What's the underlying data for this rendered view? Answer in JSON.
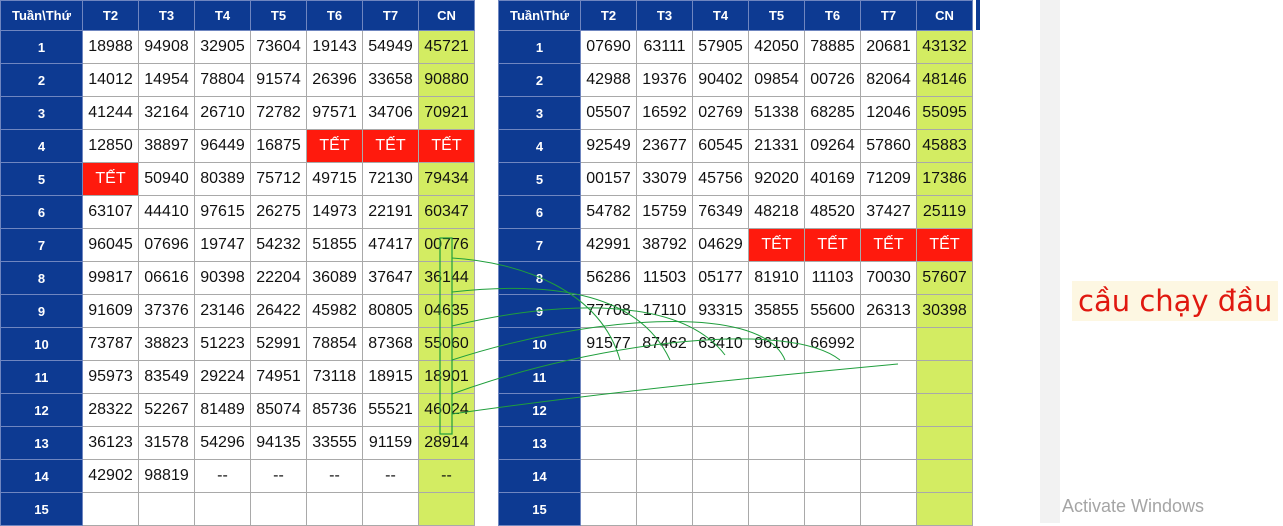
{
  "headers": [
    "Tuần\\Thứ",
    "T2",
    "T3",
    "T4",
    "T5",
    "T6",
    "T7",
    "CN"
  ],
  "left_rows": [
    {
      "week": "1",
      "values": [
        "18988",
        "94908",
        "32905",
        "73604",
        "19143",
        "54949",
        "45721"
      ]
    },
    {
      "week": "2",
      "values": [
        "14012",
        "14954",
        "78804",
        "91574",
        "26396",
        "33658",
        "90880"
      ]
    },
    {
      "week": "3",
      "values": [
        "41244",
        "32164",
        "26710",
        "72782",
        "97571",
        "34706",
        "70921"
      ]
    },
    {
      "week": "4",
      "values": [
        "12850",
        "38897",
        "96449",
        "16875",
        "TẾT",
        "TẾT",
        "TẾT"
      ]
    },
    {
      "week": "5",
      "values": [
        "TẾT",
        "50940",
        "80389",
        "75712",
        "49715",
        "72130",
        "79434"
      ]
    },
    {
      "week": "6",
      "values": [
        "63107",
        "44410",
        "97615",
        "26275",
        "14973",
        "22191",
        "60347"
      ]
    },
    {
      "week": "7",
      "values": [
        "96045",
        "07696",
        "19747",
        "54232",
        "51855",
        "47417",
        "00776"
      ]
    },
    {
      "week": "8",
      "values": [
        "99817",
        "06616",
        "90398",
        "22204",
        "36089",
        "37647",
        "36144"
      ]
    },
    {
      "week": "9",
      "values": [
        "91609",
        "37376",
        "23146",
        "26422",
        "45982",
        "80805",
        "04635"
      ]
    },
    {
      "week": "10",
      "values": [
        "73787",
        "38823",
        "51223",
        "52991",
        "78854",
        "87368",
        "55060"
      ]
    },
    {
      "week": "11",
      "values": [
        "95973",
        "83549",
        "29224",
        "74951",
        "73118",
        "18915",
        "18901"
      ]
    },
    {
      "week": "12",
      "values": [
        "28322",
        "52267",
        "81489",
        "85074",
        "85736",
        "55521",
        "46024"
      ]
    },
    {
      "week": "13",
      "values": [
        "36123",
        "31578",
        "54296",
        "94135",
        "33555",
        "91159",
        "28914"
      ]
    },
    {
      "week": "14",
      "values": [
        "42902",
        "98819",
        "--",
        "--",
        "--",
        "--",
        "--"
      ]
    },
    {
      "week": "15",
      "values": [
        "",
        "",
        "",
        "",
        "",
        "",
        ""
      ]
    }
  ],
  "right_rows": [
    {
      "week": "1",
      "values": [
        "07690",
        "63111",
        "57905",
        "42050",
        "78885",
        "20681",
        "43132"
      ]
    },
    {
      "week": "2",
      "values": [
        "42988",
        "19376",
        "90402",
        "09854",
        "00726",
        "82064",
        "48146"
      ]
    },
    {
      "week": "3",
      "values": [
        "05507",
        "16592",
        "02769",
        "51338",
        "68285",
        "12046",
        "55095"
      ]
    },
    {
      "week": "4",
      "values": [
        "92549",
        "23677",
        "60545",
        "21331",
        "09264",
        "57860",
        "45883"
      ]
    },
    {
      "week": "5",
      "values": [
        "00157",
        "33079",
        "45756",
        "92020",
        "40169",
        "71209",
        "17386"
      ]
    },
    {
      "week": "6",
      "values": [
        "54782",
        "15759",
        "76349",
        "48218",
        "48520",
        "37427",
        "25119"
      ]
    },
    {
      "week": "7",
      "values": [
        "42991",
        "38792",
        "04629",
        "TẾT",
        "TẾT",
        "TẾT",
        "TẾT"
      ]
    },
    {
      "week": "8",
      "values": [
        "56286",
        "11503",
        "05177",
        "81910",
        "11103",
        "70030",
        "57607"
      ]
    },
    {
      "week": "9",
      "values": [
        "77708",
        "17110",
        "93315",
        "35855",
        "55600",
        "26313",
        "30398"
      ]
    },
    {
      "week": "10",
      "values": [
        "91577",
        "87462",
        "63410",
        "96100",
        "66992",
        "",
        ""
      ]
    },
    {
      "week": "11",
      "values": [
        "",
        "",
        "",
        "",
        "",
        "",
        ""
      ]
    },
    {
      "week": "12",
      "values": [
        "",
        "",
        "",
        "",
        "",
        "",
        ""
      ]
    },
    {
      "week": "13",
      "values": [
        "",
        "",
        "",
        "",
        "",
        "",
        ""
      ]
    },
    {
      "week": "14",
      "values": [
        "",
        "",
        "",
        "",
        "",
        "",
        ""
      ]
    },
    {
      "week": "15",
      "values": [
        "",
        "",
        "",
        "",
        "",
        "",
        ""
      ]
    }
  ],
  "note": "cầu chạy đầu",
  "watermark": "Activate Windows",
  "colors": {
    "header_bg": "#0d3a92",
    "sunday_bg": "#d3ec62",
    "tet_bg": "#ff1a0d",
    "annotation_line": "#1f9e3c"
  }
}
